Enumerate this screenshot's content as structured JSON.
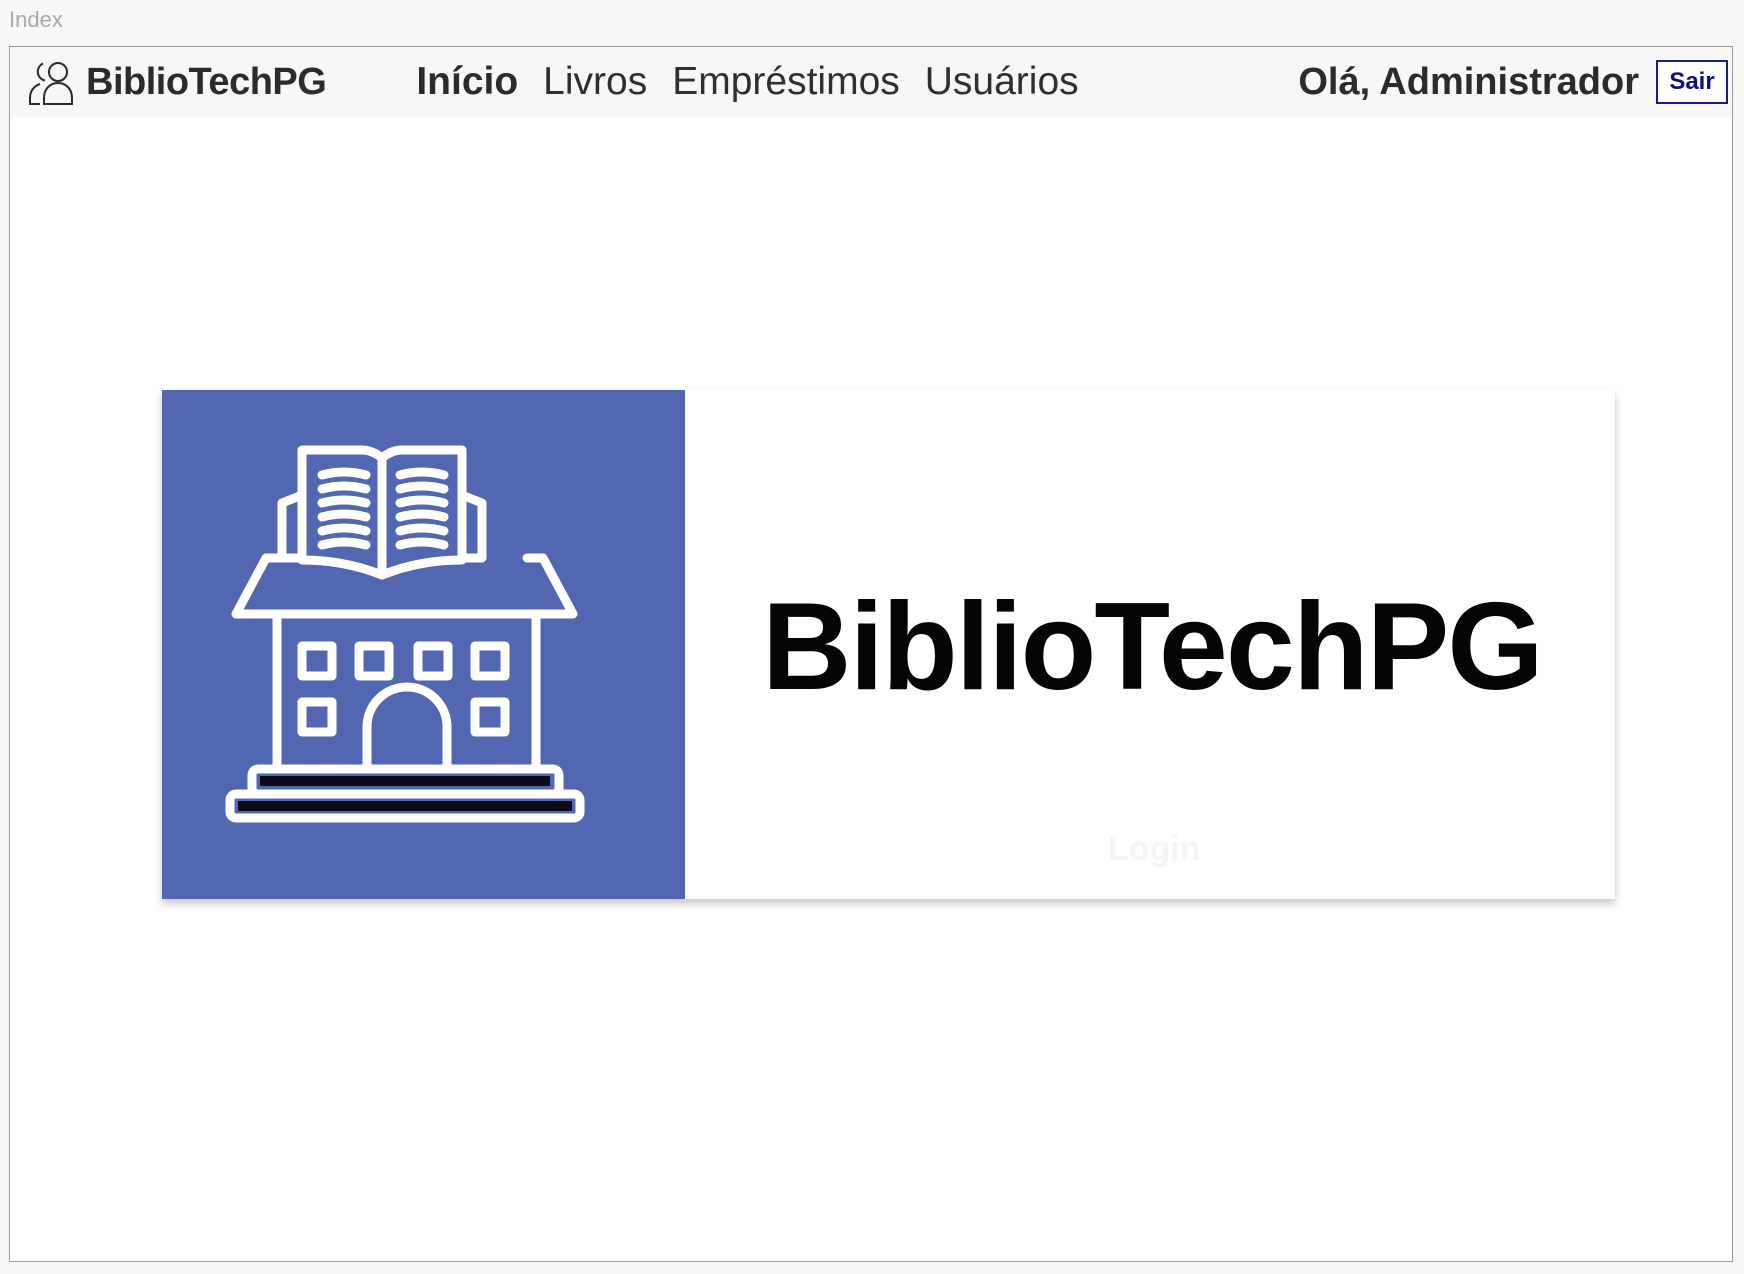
{
  "window": {
    "tab_title": "Index"
  },
  "navbar": {
    "brand_icon": "users-icon",
    "brand_name": "BiblioTechPG",
    "links": [
      {
        "label": "Início",
        "active": true
      },
      {
        "label": "Livros",
        "active": false
      },
      {
        "label": "Empréstimos",
        "active": false
      },
      {
        "label": "Usuários",
        "active": false
      }
    ],
    "greeting": "Olá, Administrador",
    "logout_label": "Sair"
  },
  "banner": {
    "logo_icon": "library-building-icon",
    "logo_background": "#5366b2",
    "title": "BiblioTechPG",
    "login_label": "Login"
  }
}
